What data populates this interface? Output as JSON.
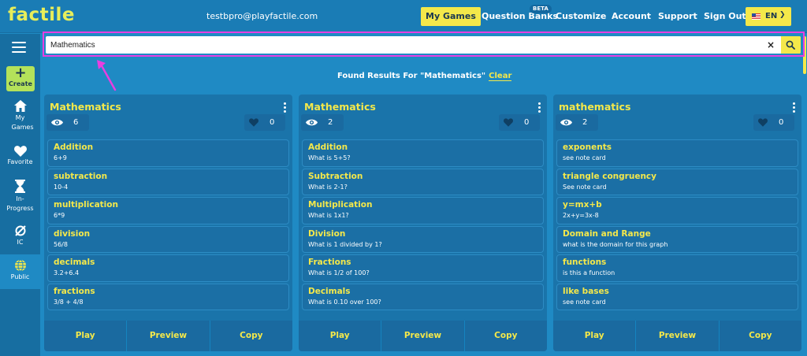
{
  "app": {
    "logo": "factile",
    "user_email": "testbpro@playfactile.com"
  },
  "nav": {
    "my_games": "My Games",
    "question_banks": "Question Banks",
    "beta_badge": "BETA",
    "customize": "Customize",
    "account": "Account",
    "support": "Support",
    "sign_out": "Sign Out",
    "language": "EN"
  },
  "sidebar": {
    "create_label": "Create",
    "items": [
      "My Games",
      "Favorite",
      "In-Progress",
      "IC",
      "Public"
    ]
  },
  "search": {
    "value": "Mathematics",
    "clear_glyph": "×"
  },
  "results": {
    "text": "Found Results For \"Mathematics\"",
    "clear_label": "Clear"
  },
  "colors": {
    "accent_yellow": "#f4e84a",
    "background_blue": "#1f8ac4",
    "highlight_magenta": "#e83ee0"
  },
  "cards": [
    {
      "title": "Mathematics",
      "views": "6",
      "likes": "0",
      "categories": [
        {
          "title": "Addition",
          "detail": "6+9"
        },
        {
          "title": "subtraction",
          "detail": "10-4"
        },
        {
          "title": "multiplication",
          "detail": "6*9"
        },
        {
          "title": "division",
          "detail": "56/8"
        },
        {
          "title": "decimals",
          "detail": "3.2+6.4"
        },
        {
          "title": "fractions",
          "detail": "3/8 + 4/8"
        }
      ],
      "actions": {
        "play": "Play",
        "preview": "Preview",
        "copy": "Copy"
      }
    },
    {
      "title": "Mathematics",
      "views": "2",
      "likes": "0",
      "categories": [
        {
          "title": "Addition",
          "detail": "What is 5+5?"
        },
        {
          "title": "Subtraction",
          "detail": "What is 2-1?"
        },
        {
          "title": "Multiplication",
          "detail": "What is 1x1?"
        },
        {
          "title": "Division",
          "detail": "What is 1 divided by 1?"
        },
        {
          "title": "Fractions",
          "detail": "What is 1/2 of 100?"
        },
        {
          "title": "Decimals",
          "detail": "What is 0.10 over 100?"
        }
      ],
      "actions": {
        "play": "Play",
        "preview": "Preview",
        "copy": "Copy"
      }
    },
    {
      "title": "mathematics",
      "views": "2",
      "likes": "0",
      "categories": [
        {
          "title": "exponents",
          "detail": "see note card"
        },
        {
          "title": "triangle congruency",
          "detail": "See note card"
        },
        {
          "title": "y=mx+b",
          "detail": "2x+y=3x-8"
        },
        {
          "title": "Domain and Range",
          "detail": "what is the domain for this graph"
        },
        {
          "title": "functions",
          "detail": "is this a function"
        },
        {
          "title": "like bases",
          "detail": "see note card"
        }
      ],
      "actions": {
        "play": "Play",
        "preview": "Preview",
        "copy": "Copy"
      }
    }
  ]
}
